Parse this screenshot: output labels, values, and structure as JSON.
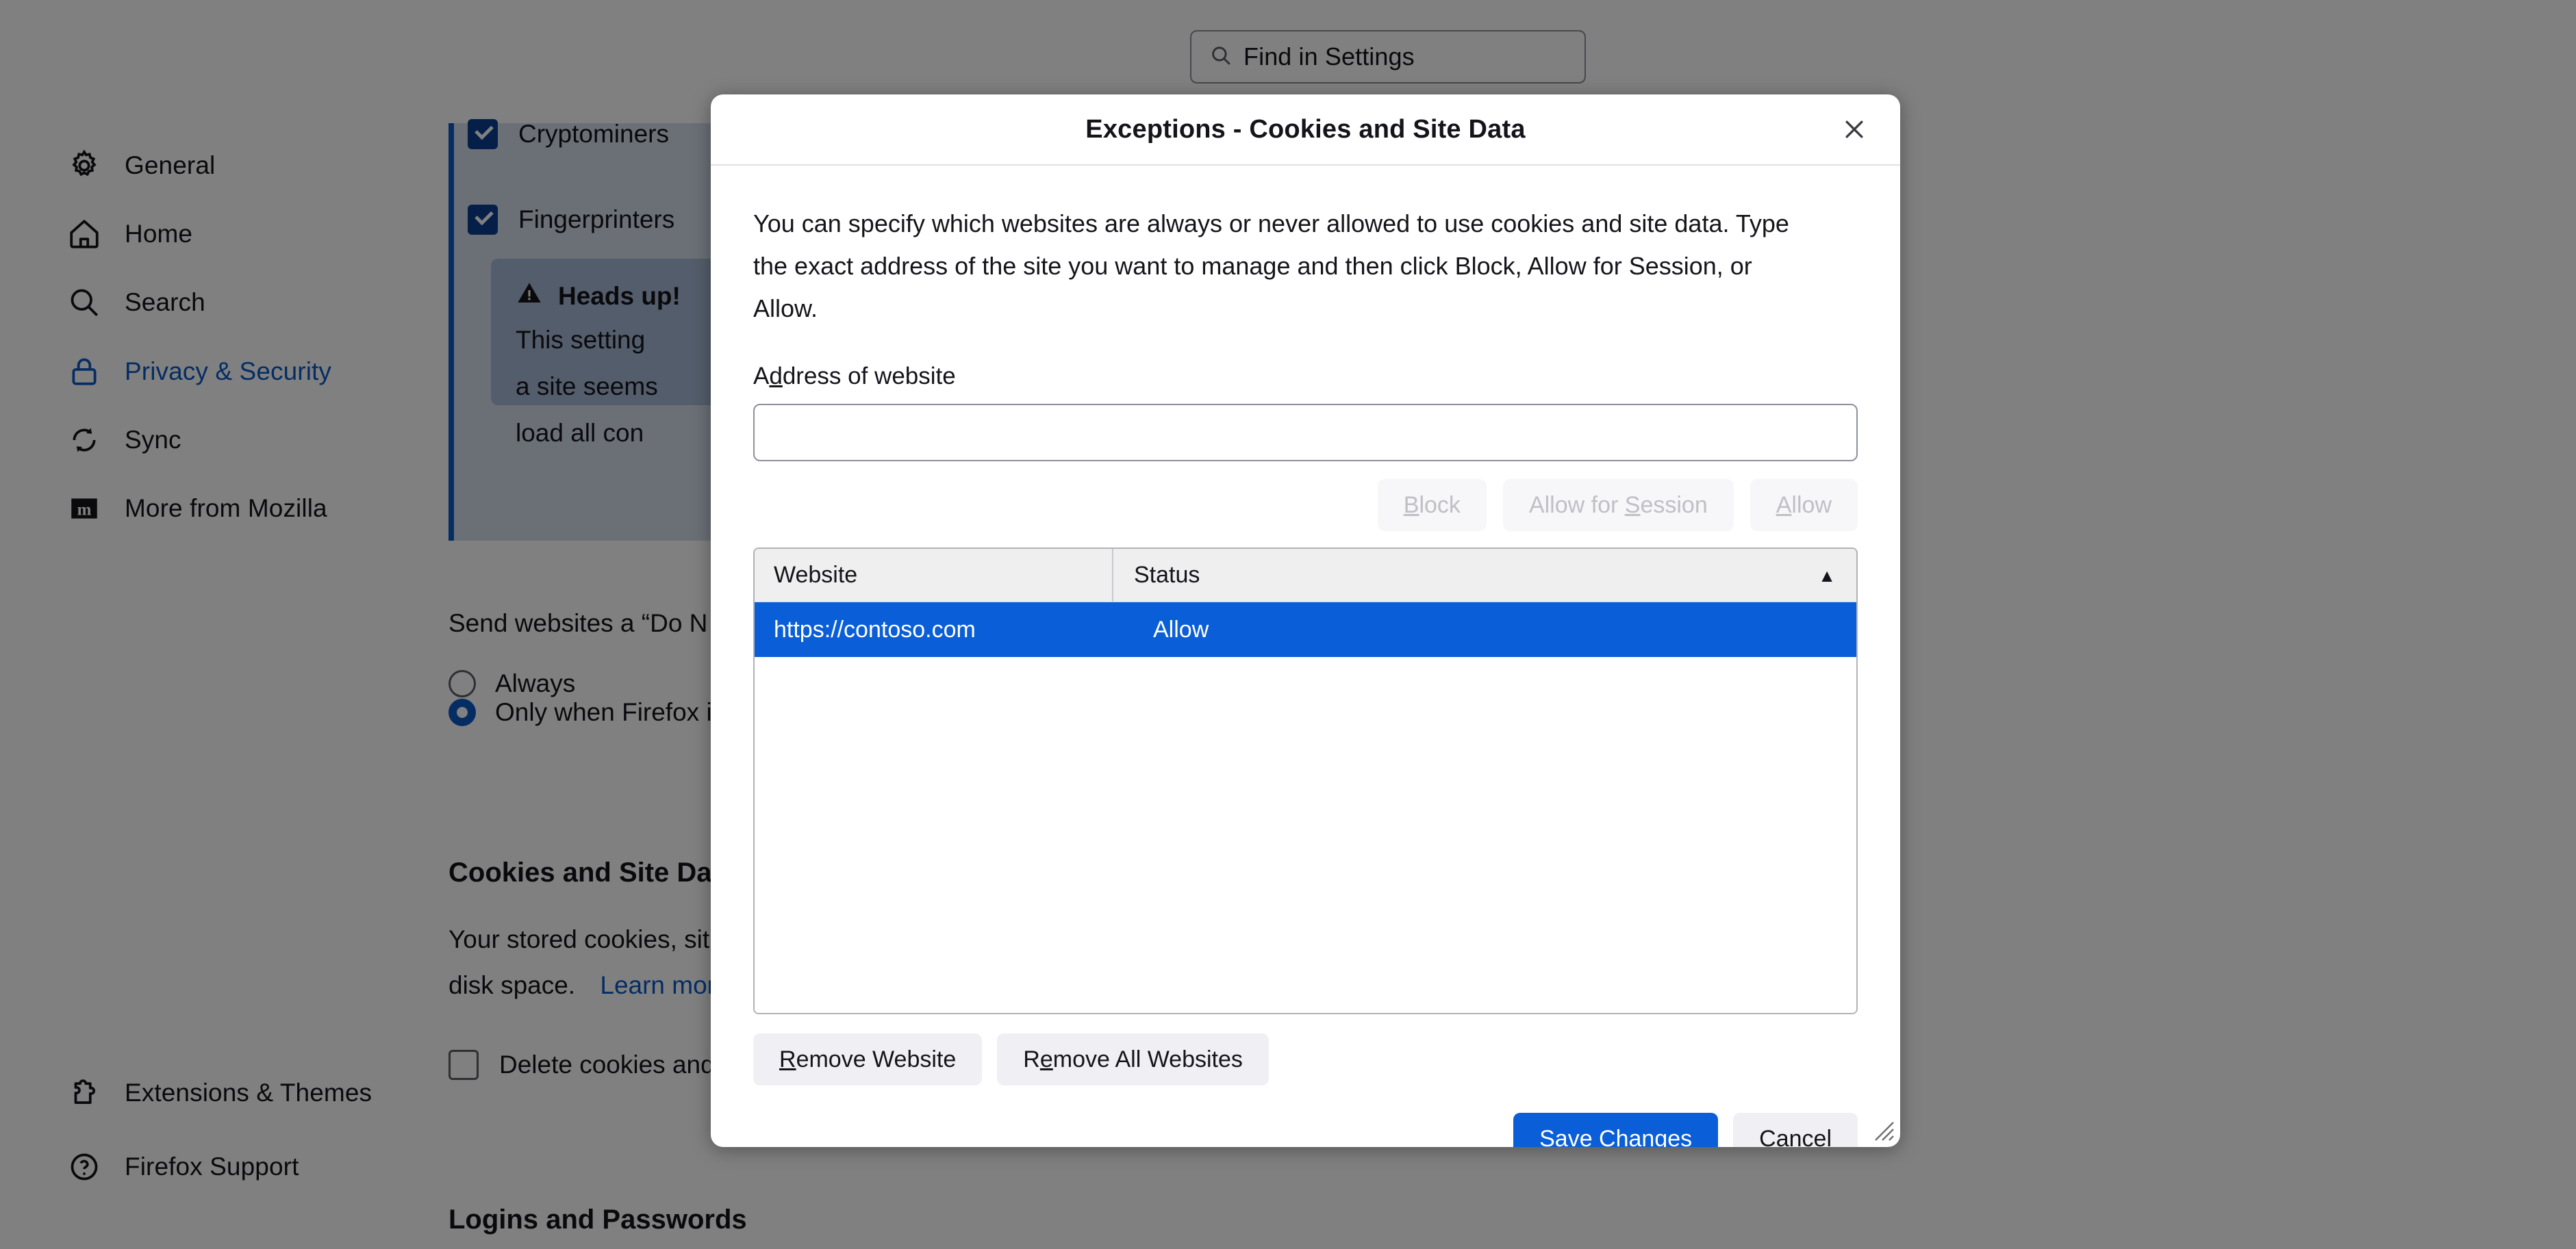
{
  "search": {
    "placeholder": "Find in Settings",
    "icon": "search-icon"
  },
  "sidebar": {
    "items": [
      {
        "label": "General",
        "icon": "gear-icon",
        "active": false
      },
      {
        "label": "Home",
        "icon": "home-icon",
        "active": false
      },
      {
        "label": "Search",
        "icon": "search-icon",
        "active": false
      },
      {
        "label": "Privacy & Security",
        "icon": "lock-icon",
        "active": true
      },
      {
        "label": "Sync",
        "icon": "sync-icon",
        "active": false
      },
      {
        "label": "More from Mozilla",
        "icon": "mozilla-m-icon",
        "active": false
      }
    ],
    "footer_items": [
      {
        "label": "Extensions & Themes",
        "icon": "puzzle-piece-icon"
      },
      {
        "label": "Firefox Support",
        "icon": "question-circle-icon"
      }
    ]
  },
  "background": {
    "checkbox_cryptominers": "Cryptominers",
    "checkbox_fingerprinters": "Fingerprinters",
    "headsup_title": "Heads up!",
    "headsup_icon": "warning-triangle-icon",
    "headsup_line1": "This setting",
    "headsup_line2": "a site seems",
    "headsup_line3": "load all con",
    "dnt_label": "Send websites a “Do N",
    "radio_always": "Always",
    "radio_only_when": "Only when Firefox is",
    "cookies_heading": "Cookies and Site Da",
    "cookies_body_line1": "Your stored cookies, sit",
    "cookies_body_line2": "disk space.",
    "cookies_learn_more": "Learn mor",
    "delete_cookies_label": "Delete cookies and",
    "logins_heading": "Logins and Passwords"
  },
  "dialog": {
    "title": "Exceptions - Cookies and Site Data",
    "close_icon": "close-icon",
    "description": "You can specify which websites are always or never allowed to use cookies and site data. Type the exact address of the site you want to manage and then click Block, Allow for Session, or Allow.",
    "address_label_prefix": "A",
    "address_label_accesskey": "d",
    "address_label_suffix": "dress of website",
    "address_value": "",
    "address_placeholder": "",
    "actions": [
      {
        "label": "Block",
        "accesskey": "B",
        "disabled": true
      },
      {
        "label": "Allow for Session",
        "accesskey": "S",
        "disabled": true
      },
      {
        "label": "Allow",
        "accesskey": "A",
        "disabled": true
      }
    ],
    "table": {
      "columns": [
        {
          "label": "Website",
          "sorted": false
        },
        {
          "label": "Status",
          "sorted": true,
          "sort_direction": "ascending",
          "sort_icon": "triangle-up-icon"
        }
      ],
      "rows": [
        {
          "website": "https://contoso.com",
          "status": "Allow",
          "selected": true
        }
      ]
    },
    "remove_buttons": [
      {
        "label": "Remove Website",
        "accesskey": "R"
      },
      {
        "label": "Remove All Websites",
        "accesskey": "e"
      }
    ],
    "footer_buttons": [
      {
        "label": "Save Changes",
        "accesskey": "S",
        "primary": true
      },
      {
        "label": "Cancel",
        "accesskey": "",
        "primary": false
      }
    ],
    "resize_grip_icon": "resize-grip-icon"
  },
  "colors": {
    "accent_blue": "#0a5ed8",
    "link_blue": "#0b5bc7",
    "selection_blue": "#0a5ed8",
    "overlay": "#808080",
    "button_bg": "#f0f0f4",
    "table_header_bg": "#efefef"
  }
}
